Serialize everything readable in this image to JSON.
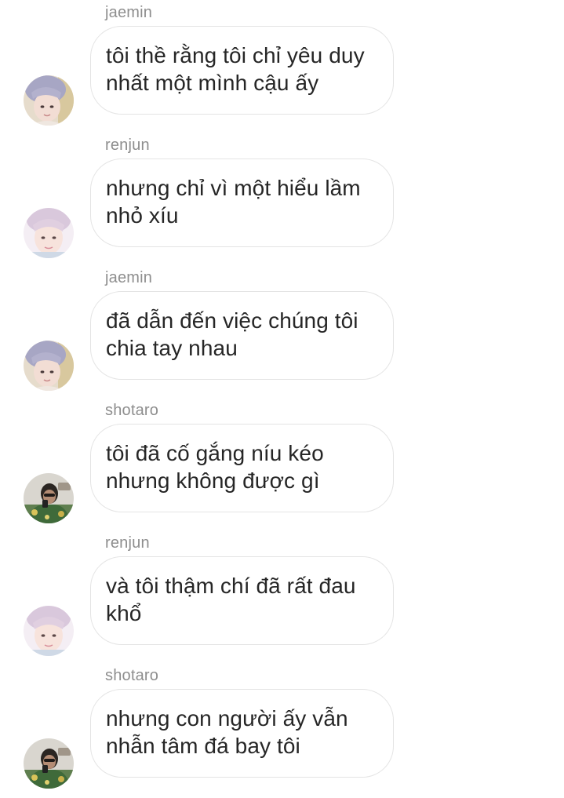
{
  "messages": [
    {
      "sender": "jaemin",
      "avatar": "jaemin-avatar",
      "lines": [
        "tôi thề rằng tôi chỉ yêu duy",
        "nhất một mình cậu ấy"
      ]
    },
    {
      "sender": "renjun",
      "avatar": "renjun-avatar",
      "lines": [
        "nhưng chỉ vì một hiểu lầm",
        "nhỏ xíu"
      ]
    },
    {
      "sender": "jaemin",
      "avatar": "jaemin-avatar",
      "lines": [
        "đã dẫn đến việc chúng tôi",
        "chia tay nhau"
      ]
    },
    {
      "sender": "shotaro",
      "avatar": "shotaro-avatar",
      "lines": [
        "tôi đã cố gắng níu kéo",
        "nhưng không được gì"
      ]
    },
    {
      "sender": "renjun",
      "avatar": "renjun-avatar",
      "lines": [
        "và tôi thậm chí đã rất đau",
        "khổ"
      ]
    },
    {
      "sender": "shotaro",
      "avatar": "shotaro-avatar",
      "lines": [
        "nhưng con người ấy vẫn",
        "nhẫn tâm đá bay tôi"
      ]
    }
  ]
}
